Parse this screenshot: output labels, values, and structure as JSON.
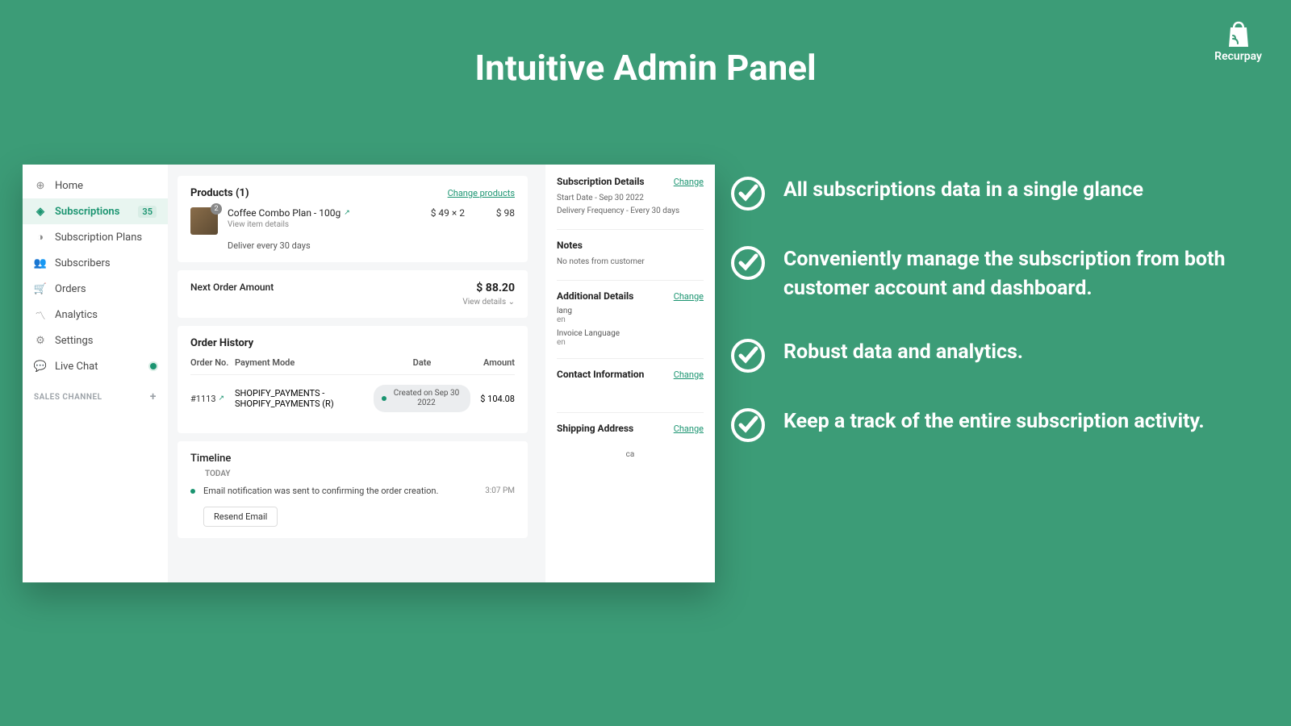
{
  "hero": {
    "title": "Intuitive Admin Panel"
  },
  "brand": {
    "name": "Recurpay"
  },
  "sidebar": {
    "items": [
      {
        "label": "Home"
      },
      {
        "label": "Subscriptions",
        "badge": "35"
      },
      {
        "label": "Subscription Plans"
      },
      {
        "label": "Subscribers"
      },
      {
        "label": "Orders"
      },
      {
        "label": "Analytics"
      },
      {
        "label": "Settings"
      },
      {
        "label": "Live Chat"
      }
    ],
    "section": "SALES CHANNEL"
  },
  "products": {
    "title": "Products (1)",
    "change": "Change products",
    "item": {
      "name": "Coffee Combo Plan - 100g",
      "sub": "View item details",
      "deliver": "Deliver every 30 days",
      "badge": "2",
      "price_each": "$ 49 × 2",
      "price_total": "$ 98"
    }
  },
  "next_order": {
    "label": "Next Order Amount",
    "amount": "$ 88.20",
    "view": "View details ⌄"
  },
  "history": {
    "title": "Order History",
    "cols": {
      "orderno": "Order No.",
      "payment": "Payment Mode",
      "date": "Date",
      "amount": "Amount"
    },
    "row": {
      "orderno": "#1113",
      "payment": "SHOPIFY_PAYMENTS - SHOPIFY_PAYMENTS (R)",
      "date": "Created on Sep 30 2022",
      "amount": "$ 104.08"
    }
  },
  "timeline": {
    "title": "Timeline",
    "today": "TODAY",
    "item": {
      "text": "Email notification was sent to                              confirming the order creation.",
      "time": "3:07 PM",
      "resend": "Resend Email"
    }
  },
  "side": {
    "sub": {
      "title": "Subscription Details",
      "change": "Change",
      "l1": "Start Date - Sep 30 2022",
      "l2": "Delivery Frequency - Every 30 days"
    },
    "notes": {
      "title": "Notes",
      "text": "No notes from customer"
    },
    "add": {
      "title": "Additional Details",
      "change": "Change",
      "k1": "lang",
      "v1": "en",
      "k2": "Invoice Language",
      "v2": "en"
    },
    "contact": {
      "title": "Contact Information",
      "change": "Change"
    },
    "ship": {
      "title": "Shipping Address",
      "change": "Change",
      "v": "ca"
    }
  },
  "features": [
    "All subscriptions data in a single glance",
    "Conveniently manage the subscription from both customer account and dashboard.",
    "Robust data and analytics.",
    "Keep a track of the entire subscription activity."
  ]
}
